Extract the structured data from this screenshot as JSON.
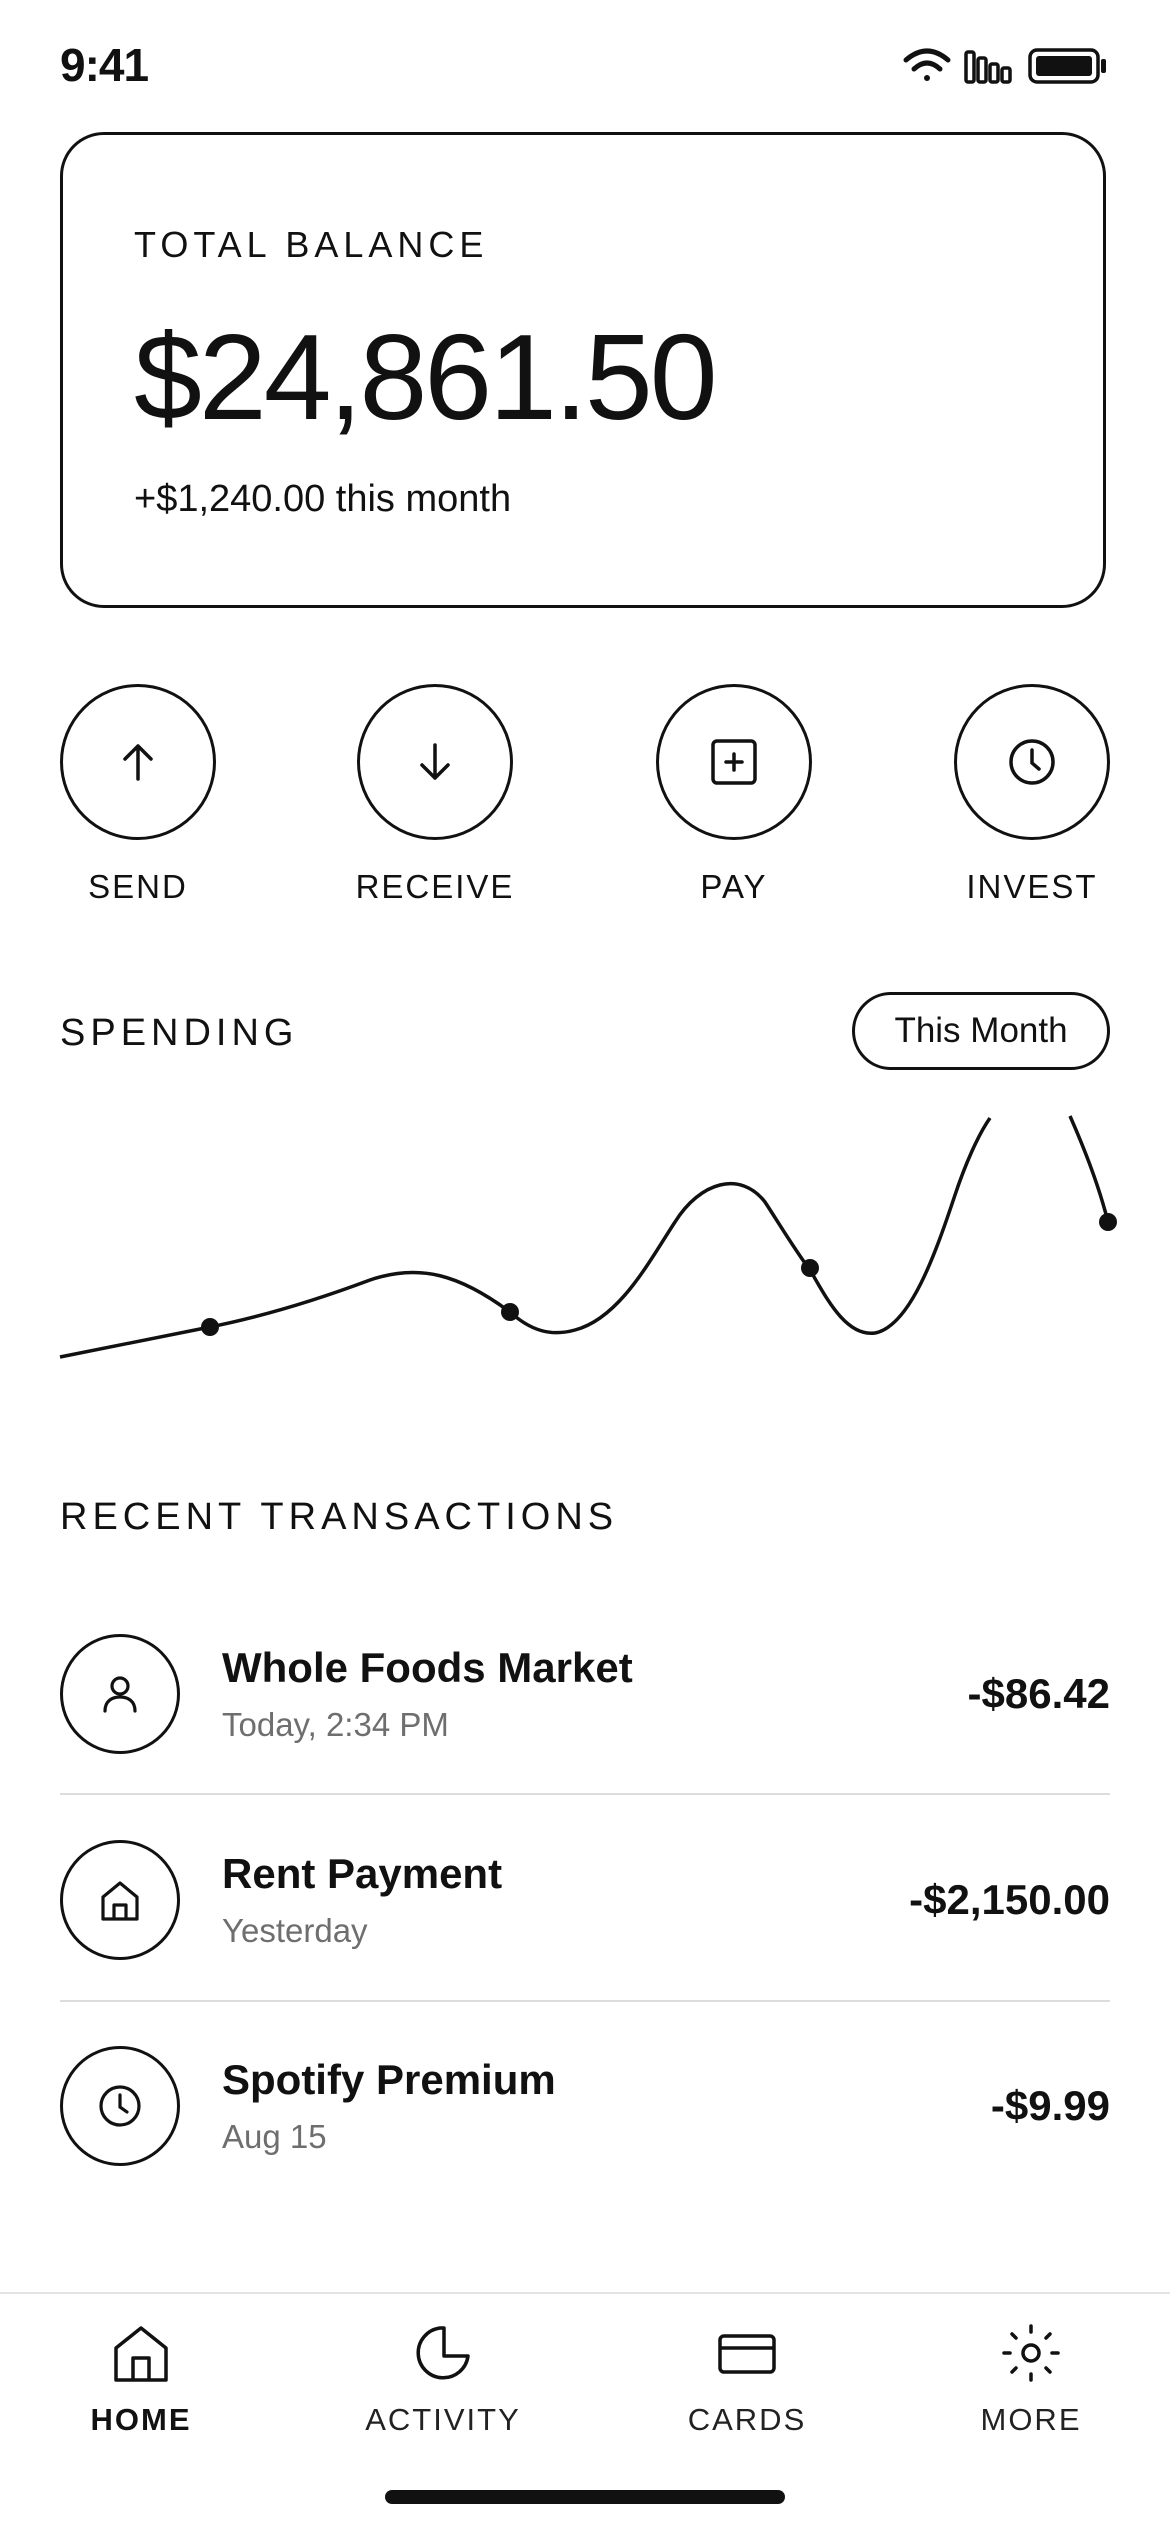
{
  "status_bar": {
    "time": "9:41"
  },
  "balance": {
    "label": "TOTAL BALANCE",
    "amount": "$24,861.50",
    "change": "+$1,240.00 this month"
  },
  "actions": [
    {
      "label": "SEND",
      "icon": "arrow-up-icon"
    },
    {
      "label": "RECEIVE",
      "icon": "arrow-down-icon"
    },
    {
      "label": "PAY",
      "icon": "plus-square-icon"
    },
    {
      "label": "INVEST",
      "icon": "clock-icon"
    }
  ],
  "spending": {
    "title": "SPENDING",
    "period": "This Month"
  },
  "transactions": {
    "title": "RECENT TRANSACTIONS",
    "items": [
      {
        "name": "Whole Foods Market",
        "time": "Today, 2:34 PM",
        "amount": "-$86.42",
        "icon": "user-icon"
      },
      {
        "name": "Rent Payment",
        "time": "Yesterday",
        "amount": "-$2,150.00",
        "icon": "home-icon"
      },
      {
        "name": "Spotify Premium",
        "time": "Aug 15",
        "amount": "-$9.99",
        "icon": "clock-icon"
      }
    ]
  },
  "tabbar": {
    "items": [
      {
        "label": "HOME",
        "icon": "home-icon",
        "active": true
      },
      {
        "label": "ACTIVITY",
        "icon": "activity-icon",
        "active": false
      },
      {
        "label": "CARDS",
        "icon": "card-icon",
        "active": false
      },
      {
        "label": "MORE",
        "icon": "sun-icon",
        "active": false
      }
    ]
  },
  "colors": {
    "ink": "#111111",
    "muted": "#6e6e6e",
    "divider": "#dcdcdc",
    "background": "#ffffff"
  }
}
